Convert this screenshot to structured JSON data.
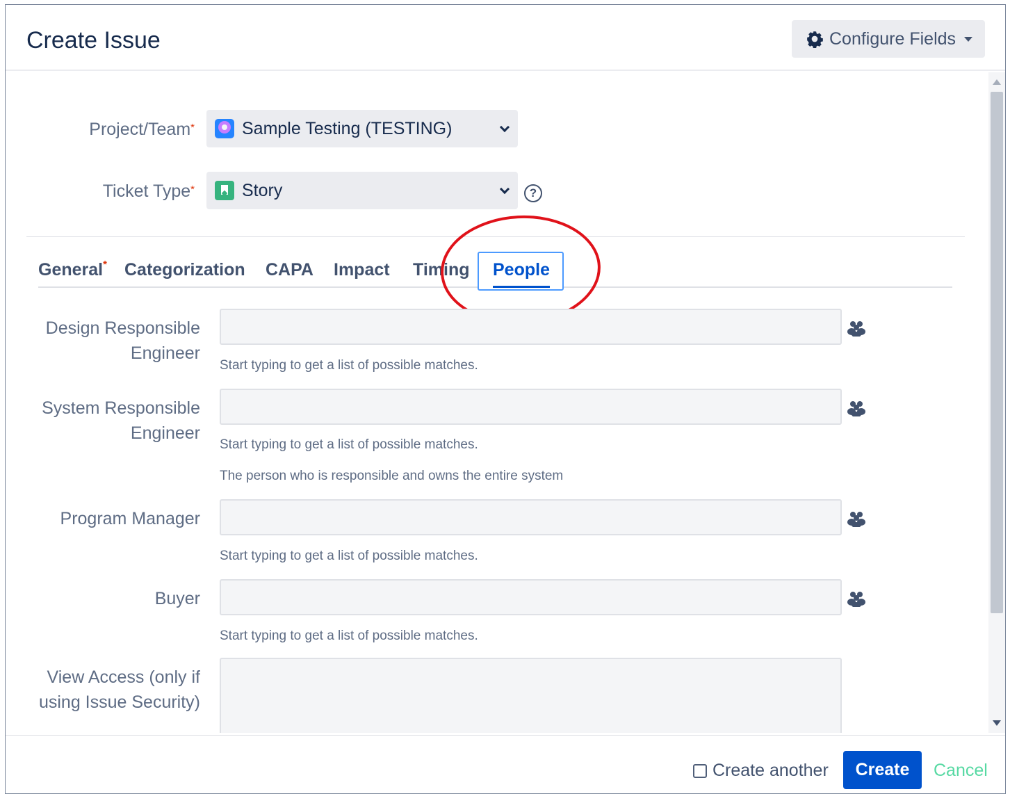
{
  "header": {
    "title": "Create Issue",
    "configure_fields_label": "Configure Fields"
  },
  "project": {
    "label": "Project/Team",
    "required_mark": "*",
    "value": "Sample Testing (TESTING)"
  },
  "ticket_type": {
    "label": "Ticket Type",
    "required_mark": "*",
    "value": "Story",
    "help_glyph": "?"
  },
  "tabs": [
    {
      "label": "General",
      "required_mark": "*"
    },
    {
      "label": "Categorization"
    },
    {
      "label": "CAPA"
    },
    {
      "label": "Impact"
    },
    {
      "label": "Timing"
    },
    {
      "label": "People",
      "active": true
    }
  ],
  "fields": {
    "design_engineer": {
      "label_line1": "Design Responsible",
      "label_line2": "Engineer",
      "hint": "Start typing to get a list of possible matches."
    },
    "system_engineer": {
      "label_line1": "System Responsible",
      "label_line2": "Engineer",
      "hint": "Start typing to get a list of possible matches.",
      "description": "The person who is responsible and owns the entire system"
    },
    "program_manager": {
      "label": "Program Manager",
      "hint": "Start typing to get a list of possible matches."
    },
    "buyer": {
      "label": "Buyer",
      "hint": "Start typing to get a list of possible matches."
    },
    "view_access": {
      "label_line1": "View Access (only if",
      "label_line2": "using Issue Security)"
    }
  },
  "footer": {
    "create_another_label": "Create another",
    "create_another_checked": false,
    "create_label": "Create",
    "cancel_label": "Cancel"
  },
  "icons": {
    "configure": "gear-icon",
    "project": "project-avatar-icon",
    "ticket_type": "story-icon",
    "help": "help-icon",
    "user_picker": "people-icon"
  },
  "colors": {
    "primary": "#0052cc",
    "tab_focus": "#4c9aff",
    "required": "#de350b",
    "annotation": "#e0121a",
    "cancel": "#57d9a3"
  }
}
